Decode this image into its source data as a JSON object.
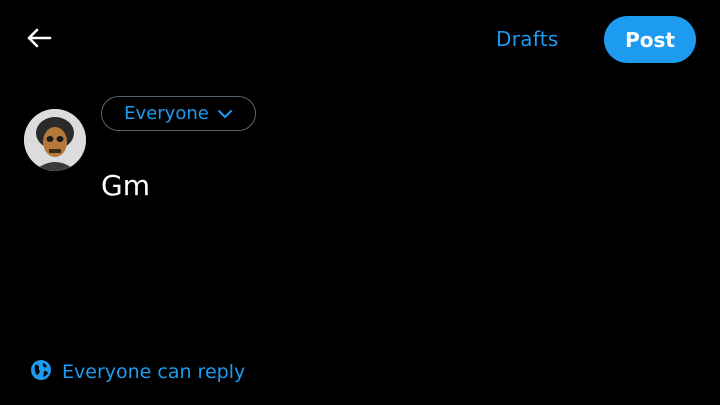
{
  "header": {
    "back_icon": "arrow-left-icon",
    "drafts_label": "Drafts",
    "post_label": "Post"
  },
  "composer": {
    "avatar_icon": "user-avatar",
    "audience_label": "Everyone",
    "audience_icon": "chevron-down-icon",
    "text": "Gm"
  },
  "footer": {
    "reply_icon": "globe-icon",
    "reply_label": "Everyone can reply"
  },
  "colors": {
    "accent": "#1d9bf0",
    "background": "#000000",
    "text": "#ffffff",
    "border": "#536471"
  }
}
